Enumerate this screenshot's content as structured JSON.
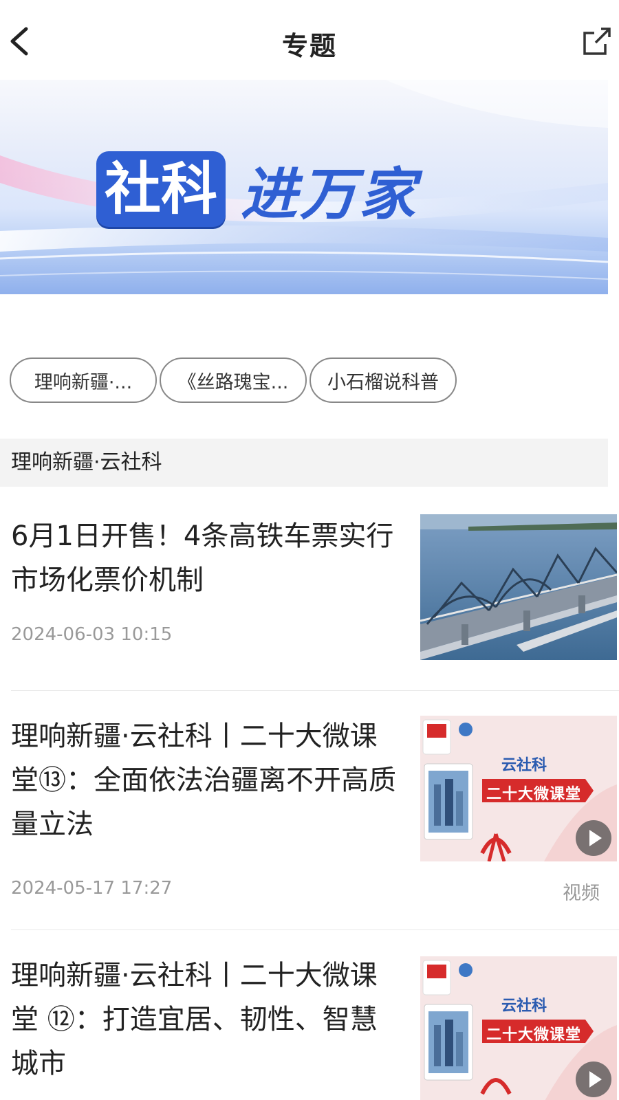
{
  "header": {
    "title": "专题",
    "back_icon": "chevron-left-icon",
    "share_icon": "share-external-icon"
  },
  "banner": {
    "tag_text": "社科",
    "rest_text": "进万家",
    "accent_color": "#2f5fd3"
  },
  "chips": [
    {
      "label": "理响新疆·..."
    },
    {
      "label": "《丝路瑰宝..."
    },
    {
      "label": "小石榴说科普"
    }
  ],
  "section": {
    "title": "理响新疆·云社科"
  },
  "articles": [
    {
      "title": "6月1日开售！4条高铁车票实行市场化票价机制",
      "date": "2024-06-03 10:15",
      "tag": ""
    },
    {
      "title": "理响新疆·云社科丨二十大微课堂⑬：全面依法治疆离不开高质量立法",
      "date": "2024-05-17 17:27",
      "tag": "视频",
      "thumb_text_top": "云社科",
      "thumb_text_main": "二十大微课堂"
    },
    {
      "title": "理响新疆·云社科丨二十大微课堂 ⑫：打造宜居、韧性、智慧城市",
      "date": "",
      "tag": "",
      "thumb_text_top": "云社科",
      "thumb_text_main": "二十大微课堂"
    }
  ]
}
